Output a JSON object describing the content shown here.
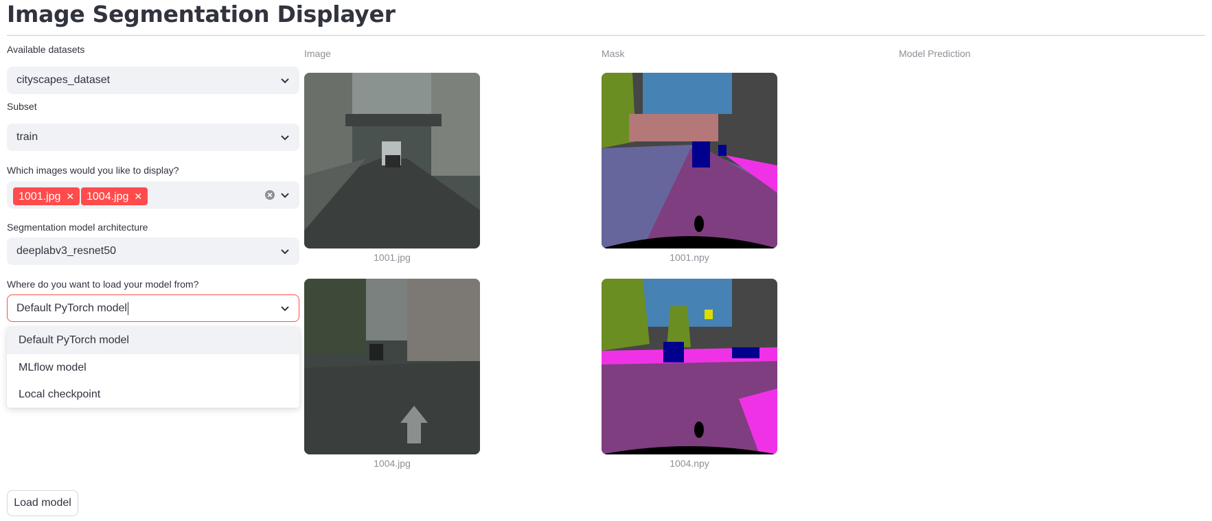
{
  "page": {
    "title": "Image Segmentation Displayer"
  },
  "sidebar": {
    "dataset": {
      "label": "Available datasets",
      "value": "cityscapes_dataset"
    },
    "subset": {
      "label": "Subset",
      "value": "train"
    },
    "images": {
      "label": "Which images would you like to display?",
      "selected": [
        "1001.jpg",
        "1004.jpg"
      ]
    },
    "architecture": {
      "label": "Segmentation model architecture",
      "value": "deeplabv3_resnet50"
    },
    "source": {
      "label": "Where do you want to load your model from?",
      "value": "Default PyTorch model",
      "options": [
        "Default PyTorch model",
        "MLflow model",
        "Local checkpoint"
      ]
    },
    "load_button": "Load model"
  },
  "columns": {
    "image": "Image",
    "mask": "Mask",
    "prediction": "Model Prediction"
  },
  "rows": [
    {
      "image_caption": "1001.jpg",
      "mask_caption": "1001.npy"
    },
    {
      "image_caption": "1004.jpg",
      "mask_caption": "1004.npy"
    }
  ],
  "colors": {
    "accent": "#ff4b4b",
    "input_bg": "#f0f2f6",
    "mask_road": "#7f3e7f",
    "mask_sidewalk": "#f032e6",
    "mask_building": "#464646",
    "mask_vegetation": "#6b8e23",
    "mask_sky": "#4682b4",
    "mask_car": "#00008e",
    "mask_wall": "#66669c"
  }
}
